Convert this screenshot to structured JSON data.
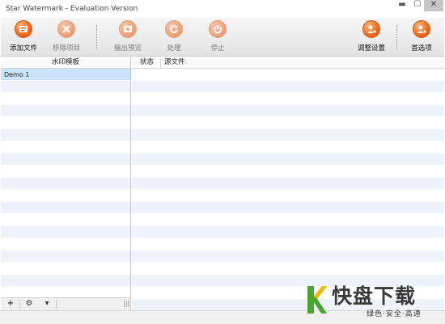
{
  "window": {
    "title": "Star Watermark - Evaluation Version",
    "controls": {
      "minimize": "▬",
      "maximize": "☐",
      "close": "✕"
    }
  },
  "toolbar": {
    "add_file": {
      "label": "添加文件",
      "icon": "add-file-icon"
    },
    "remove_item": {
      "label": "移除项目",
      "icon": "remove-icon",
      "disabled": true
    },
    "output_preview": {
      "label": "输出预览",
      "icon": "preview-icon",
      "disabled": true
    },
    "process": {
      "label": "处理",
      "icon": "refresh-icon",
      "disabled": true
    },
    "stop": {
      "label": "停止",
      "icon": "power-icon",
      "disabled": true
    },
    "adjust_settings": {
      "label": "调整设置",
      "icon": "settings-user-icon"
    },
    "preferences": {
      "label": "首选项",
      "icon": "gear-user-icon"
    }
  },
  "template_panel": {
    "header": "水印模板",
    "items": [
      "Demo 1"
    ],
    "footer": {
      "add": "+",
      "gear": "⚙",
      "dropdown": "▼",
      "grip": "|||"
    }
  },
  "file_list": {
    "columns": [
      "状态",
      "源文件"
    ],
    "rows": []
  },
  "watermark_logo": {
    "main_text": "快盘下载",
    "tagline": "绿色·安全·高速"
  },
  "colors": {
    "accent_orange": "#f06a1c",
    "row_alt": "#eef2fb",
    "row_selected": "#cce4fb",
    "logo_green": "#4aa62e"
  }
}
